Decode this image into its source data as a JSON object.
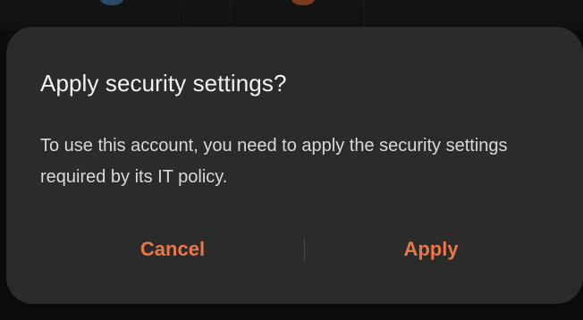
{
  "dialog": {
    "title": "Apply security settings?",
    "message": "To use this account, you need to apply the security settings required by its IT policy.",
    "buttons": {
      "cancel_label": "Cancel",
      "apply_label": "Apply"
    }
  },
  "colors": {
    "accent": "#e8784a",
    "dialog_background": "#2b2b2b",
    "screen_background": "#0b0b0b",
    "title_text": "#f2f2f2",
    "body_text": "#d9d9d9"
  }
}
